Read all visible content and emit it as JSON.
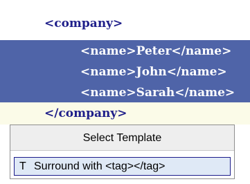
{
  "editor": {
    "lines": [
      "<company>",
      "<name>Peter</name>",
      "<name>John</name>",
      "<name>Sarah</name>",
      "</company>"
    ]
  },
  "popup": {
    "title": "Select Template",
    "items": [
      {
        "key": "T",
        "label": "Surround with <tag></tag>"
      }
    ]
  },
  "colors": {
    "selection": "#4f64a8",
    "current_line": "#fbfbe8",
    "tag_text": "#1f1f8a",
    "popup_item_border": "#1a1a8a"
  }
}
